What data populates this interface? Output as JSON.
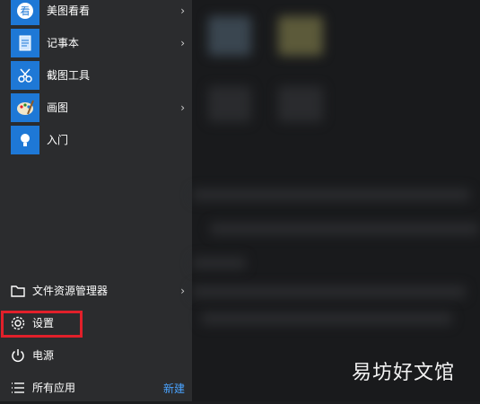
{
  "apps": [
    {
      "label": "美图看看",
      "icon": "meitu-icon",
      "has_submenu": true
    },
    {
      "label": "记事本",
      "icon": "notepad-icon",
      "has_submenu": true
    },
    {
      "label": "截图工具",
      "icon": "scissors-icon",
      "has_submenu": false
    },
    {
      "label": "画图",
      "icon": "paint-palette-icon",
      "has_submenu": true
    },
    {
      "label": "入门",
      "icon": "lightbulb-icon",
      "has_submenu": false
    }
  ],
  "system": {
    "explorer": {
      "label": "文件资源管理器",
      "icon": "folder-icon"
    },
    "settings": {
      "label": "设置",
      "icon": "gear-icon"
    },
    "power": {
      "label": "电源",
      "icon": "power-icon"
    },
    "all_apps": {
      "label": "所有应用",
      "icon": "list-icon",
      "new_label": "新建"
    }
  },
  "watermark": "易坊好文馆",
  "colors": {
    "tile": "#1e78d6",
    "highlight": "#e1202a",
    "link": "#4aa3ff"
  }
}
